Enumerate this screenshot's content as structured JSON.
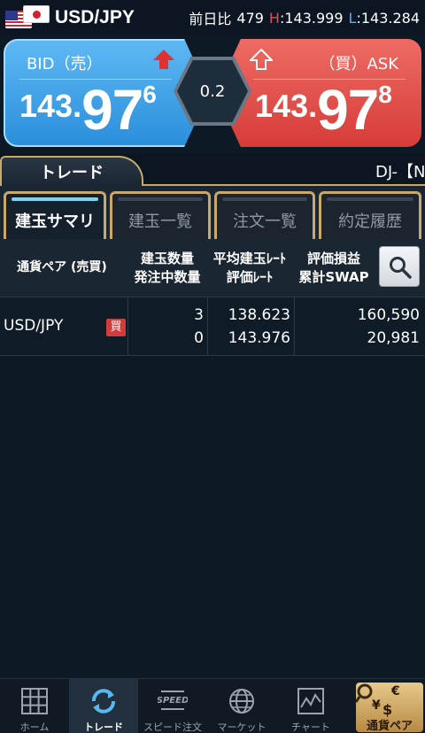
{
  "header": {
    "pair": "USD/JPY",
    "change_label": "前日比",
    "change_value": "479",
    "high_label": "H",
    "high_value": "143.999",
    "low_label": "L",
    "low_value": "143.284"
  },
  "price": {
    "bid_label": "BID（売）",
    "ask_label": "（買）ASK",
    "bid_small": "143.",
    "bid_big": "97",
    "bid_pip": "6",
    "ask_small": "143.",
    "ask_big": "97",
    "ask_pip": "8",
    "spread": "0.2",
    "colors": {
      "bid": "#3fa3e8",
      "ask": "#e2504b"
    }
  },
  "section": {
    "tab_label": "トレード",
    "ticker": "DJ-【N"
  },
  "subtabs": [
    {
      "label": "建玉サマリ",
      "active": true
    },
    {
      "label": "建玉一覧",
      "active": false
    },
    {
      "label": "注文一覧",
      "active": false
    },
    {
      "label": "約定履歴",
      "active": false
    }
  ],
  "table": {
    "headers": {
      "pair": "通貨ペア (売買)",
      "qty_1": "建玉数量",
      "qty_2": "発注中数量",
      "rate_1": "平均建玉ﾚｰﾄ",
      "rate_2": "評価ﾚｰﾄ",
      "pl_1": "評価損益",
      "pl_2": "累計SWAP"
    },
    "rows": [
      {
        "pair": "USD/JPY",
        "side": "買",
        "position_qty": "3",
        "pending_qty": "0",
        "avg_rate": "138.623",
        "eval_rate": "143.976",
        "eval_pl": "160,590",
        "swap": "20,981"
      }
    ]
  },
  "nav": {
    "items": [
      {
        "label": "ホーム",
        "icon": "grid-icon"
      },
      {
        "label": "トレード",
        "icon": "refresh-icon",
        "active": true
      },
      {
        "label": "スピード注文",
        "icon": "speed-icon"
      },
      {
        "label": "マーケット",
        "icon": "globe-icon"
      },
      {
        "label": "チャート",
        "icon": "chart-icon"
      }
    ],
    "pair_button": "通貨ペア",
    "speed_text": "SPEED"
  }
}
